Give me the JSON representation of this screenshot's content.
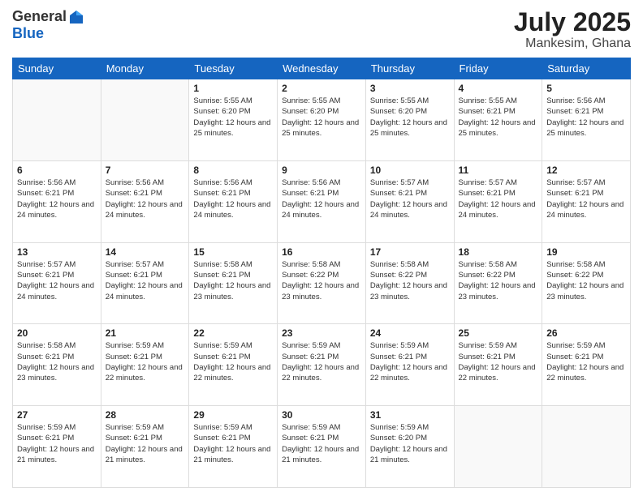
{
  "logo": {
    "general": "General",
    "blue": "Blue"
  },
  "title": {
    "month_year": "July 2025",
    "location": "Mankesim, Ghana"
  },
  "days_of_week": [
    "Sunday",
    "Monday",
    "Tuesday",
    "Wednesday",
    "Thursday",
    "Friday",
    "Saturday"
  ],
  "weeks": [
    [
      {
        "day": "",
        "info": ""
      },
      {
        "day": "",
        "info": ""
      },
      {
        "day": "1",
        "info": "Sunrise: 5:55 AM\nSunset: 6:20 PM\nDaylight: 12 hours and 25 minutes."
      },
      {
        "day": "2",
        "info": "Sunrise: 5:55 AM\nSunset: 6:20 PM\nDaylight: 12 hours and 25 minutes."
      },
      {
        "day": "3",
        "info": "Sunrise: 5:55 AM\nSunset: 6:20 PM\nDaylight: 12 hours and 25 minutes."
      },
      {
        "day": "4",
        "info": "Sunrise: 5:55 AM\nSunset: 6:21 PM\nDaylight: 12 hours and 25 minutes."
      },
      {
        "day": "5",
        "info": "Sunrise: 5:56 AM\nSunset: 6:21 PM\nDaylight: 12 hours and 25 minutes."
      }
    ],
    [
      {
        "day": "6",
        "info": "Sunrise: 5:56 AM\nSunset: 6:21 PM\nDaylight: 12 hours and 24 minutes."
      },
      {
        "day": "7",
        "info": "Sunrise: 5:56 AM\nSunset: 6:21 PM\nDaylight: 12 hours and 24 minutes."
      },
      {
        "day": "8",
        "info": "Sunrise: 5:56 AM\nSunset: 6:21 PM\nDaylight: 12 hours and 24 minutes."
      },
      {
        "day": "9",
        "info": "Sunrise: 5:56 AM\nSunset: 6:21 PM\nDaylight: 12 hours and 24 minutes."
      },
      {
        "day": "10",
        "info": "Sunrise: 5:57 AM\nSunset: 6:21 PM\nDaylight: 12 hours and 24 minutes."
      },
      {
        "day": "11",
        "info": "Sunrise: 5:57 AM\nSunset: 6:21 PM\nDaylight: 12 hours and 24 minutes."
      },
      {
        "day": "12",
        "info": "Sunrise: 5:57 AM\nSunset: 6:21 PM\nDaylight: 12 hours and 24 minutes."
      }
    ],
    [
      {
        "day": "13",
        "info": "Sunrise: 5:57 AM\nSunset: 6:21 PM\nDaylight: 12 hours and 24 minutes."
      },
      {
        "day": "14",
        "info": "Sunrise: 5:57 AM\nSunset: 6:21 PM\nDaylight: 12 hours and 24 minutes."
      },
      {
        "day": "15",
        "info": "Sunrise: 5:58 AM\nSunset: 6:21 PM\nDaylight: 12 hours and 23 minutes."
      },
      {
        "day": "16",
        "info": "Sunrise: 5:58 AM\nSunset: 6:22 PM\nDaylight: 12 hours and 23 minutes."
      },
      {
        "day": "17",
        "info": "Sunrise: 5:58 AM\nSunset: 6:22 PM\nDaylight: 12 hours and 23 minutes."
      },
      {
        "day": "18",
        "info": "Sunrise: 5:58 AM\nSunset: 6:22 PM\nDaylight: 12 hours and 23 minutes."
      },
      {
        "day": "19",
        "info": "Sunrise: 5:58 AM\nSunset: 6:22 PM\nDaylight: 12 hours and 23 minutes."
      }
    ],
    [
      {
        "day": "20",
        "info": "Sunrise: 5:58 AM\nSunset: 6:21 PM\nDaylight: 12 hours and 23 minutes."
      },
      {
        "day": "21",
        "info": "Sunrise: 5:59 AM\nSunset: 6:21 PM\nDaylight: 12 hours and 22 minutes."
      },
      {
        "day": "22",
        "info": "Sunrise: 5:59 AM\nSunset: 6:21 PM\nDaylight: 12 hours and 22 minutes."
      },
      {
        "day": "23",
        "info": "Sunrise: 5:59 AM\nSunset: 6:21 PM\nDaylight: 12 hours and 22 minutes."
      },
      {
        "day": "24",
        "info": "Sunrise: 5:59 AM\nSunset: 6:21 PM\nDaylight: 12 hours and 22 minutes."
      },
      {
        "day": "25",
        "info": "Sunrise: 5:59 AM\nSunset: 6:21 PM\nDaylight: 12 hours and 22 minutes."
      },
      {
        "day": "26",
        "info": "Sunrise: 5:59 AM\nSunset: 6:21 PM\nDaylight: 12 hours and 22 minutes."
      }
    ],
    [
      {
        "day": "27",
        "info": "Sunrise: 5:59 AM\nSunset: 6:21 PM\nDaylight: 12 hours and 21 minutes."
      },
      {
        "day": "28",
        "info": "Sunrise: 5:59 AM\nSunset: 6:21 PM\nDaylight: 12 hours and 21 minutes."
      },
      {
        "day": "29",
        "info": "Sunrise: 5:59 AM\nSunset: 6:21 PM\nDaylight: 12 hours and 21 minutes."
      },
      {
        "day": "30",
        "info": "Sunrise: 5:59 AM\nSunset: 6:21 PM\nDaylight: 12 hours and 21 minutes."
      },
      {
        "day": "31",
        "info": "Sunrise: 5:59 AM\nSunset: 6:20 PM\nDaylight: 12 hours and 21 minutes."
      },
      {
        "day": "",
        "info": ""
      },
      {
        "day": "",
        "info": ""
      }
    ]
  ]
}
